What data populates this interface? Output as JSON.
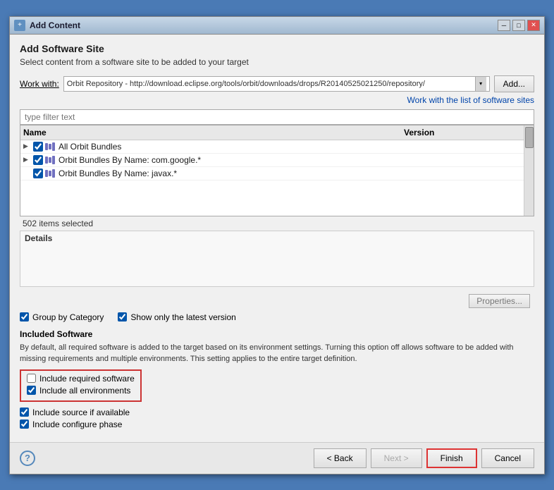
{
  "window": {
    "title": "Add Content",
    "icon": "+"
  },
  "title_controls": {
    "minimize": "─",
    "maximize": "□",
    "close": "✕"
  },
  "header": {
    "section_title": "Add Software Site",
    "subtitle": "Select content from a software site to be added to your target"
  },
  "work_with": {
    "label": "Work with:",
    "value": "Orbit Repository - http://download.eclipse.org/tools/orbit/downloads/drops/R20140525021250/repository/",
    "add_button": "Add..."
  },
  "software_link": "Work with the list of software sites",
  "filter": {
    "placeholder": "type filter text"
  },
  "list": {
    "columns": [
      "Name",
      "Version"
    ],
    "items": [
      {
        "expanded": false,
        "checked": true,
        "name": "All Orbit Bundles",
        "version": ""
      },
      {
        "expanded": false,
        "checked": true,
        "name": "Orbit Bundles By Name: com.google.*",
        "version": ""
      },
      {
        "expanded": false,
        "checked": true,
        "name": "Orbit Bundles By Name: javax.*",
        "version": ""
      }
    ]
  },
  "status": {
    "items_selected": "502 items selected"
  },
  "details": {
    "label": "Details"
  },
  "properties_button": "Properties...",
  "checkboxes": {
    "group_by_category": {
      "label": "Group by Category",
      "checked": true
    },
    "show_latest": {
      "label": "Show only the latest version",
      "checked": true
    }
  },
  "included_software": {
    "title": "Included Software",
    "description": "By default, all required software is added to the target based on its environment settings. Turning this option off allows software to be added with missing requirements and multiple environments.  This setting applies to the entire target definition.",
    "checkboxes": [
      {
        "label": "Include required software",
        "checked": false
      },
      {
        "label": "Include all environments",
        "checked": true
      }
    ]
  },
  "extra_checkboxes": [
    {
      "label": "Include source if available",
      "checked": true
    },
    {
      "label": "Include configure phase",
      "checked": true
    }
  ],
  "footer": {
    "help_symbol": "?",
    "back_button": "< Back",
    "next_button": "Next >",
    "finish_button": "Finish",
    "cancel_button": "Cancel"
  }
}
